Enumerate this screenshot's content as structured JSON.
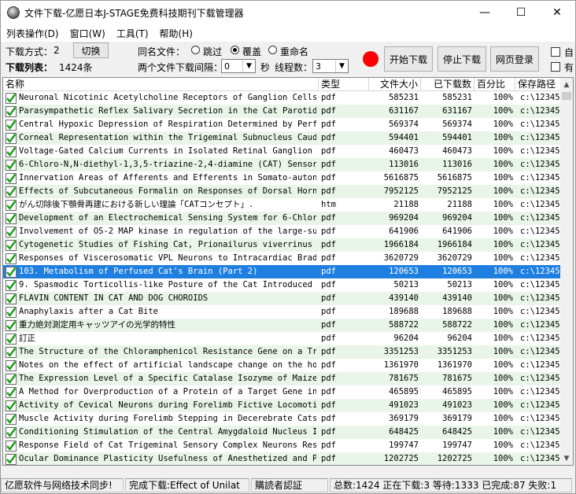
{
  "window": {
    "title": "文件下载-亿愿日本J-STAGE免费科技期刊下载管理器",
    "minimize": "—",
    "maximize": "☐",
    "close": "✕"
  },
  "menu": {
    "items": [
      "列表操作(D)",
      "窗口(W)",
      "工具(T)",
      "帮助(H)"
    ]
  },
  "toolbar": {
    "download_mode_label": "下载方式：",
    "download_mode_value": "2",
    "switch_button": "切换",
    "download_list_label": "下载列表：",
    "download_list_count": "1424条",
    "same_name_label": "同名文件：",
    "radio_skip": "跳过",
    "radio_overwrite": "覆盖",
    "radio_rename": "重命名",
    "interval_label": "两个文件下载间隔：",
    "interval_value": "0",
    "seconds_label": "秒",
    "threads_label": "线程数：",
    "threads_value": "3",
    "start_button": "开始下载",
    "stop_button": "停止下载",
    "web_login_button": "网页登录",
    "check1_label": "自",
    "check2_label": "有"
  },
  "table": {
    "columns": [
      "名称",
      "类型",
      "文件大小",
      "已下载数",
      "百分比",
      "保存路径"
    ],
    "rows": [
      {
        "name": "Neuronal Nicotinic Acetylcholine Receptors of Ganglion Cells...",
        "type": "pdf",
        "size": "585231",
        "done": "585231",
        "pct": "100%",
        "path": "c:\\12345"
      },
      {
        "name": "Parasympathetic Reflex Salivary Secretion in the Cat Parotid...",
        "type": "pdf",
        "size": "631167",
        "done": "631167",
        "pct": "100%",
        "path": "c:\\12345"
      },
      {
        "name": "Central Hypoxic Depression of Respiration Determined by Perf...",
        "type": "pdf",
        "size": "569374",
        "done": "569374",
        "pct": "100%",
        "path": "c:\\12345"
      },
      {
        "name": "Corneal Representation within the Trigeminal Subnucleus Caud...",
        "type": "pdf",
        "size": "594401",
        "done": "594401",
        "pct": "100%",
        "path": "c:\\12345"
      },
      {
        "name": "Voltage-Gated Calcium Currents in Isolated Retinal Ganglion ...",
        "type": "pdf",
        "size": "460473",
        "done": "460473",
        "pct": "100%",
        "path": "c:\\12345"
      },
      {
        "name": "6-Chloro-N,N-diethyl-1,3,5-triazine-2,4-diamine (CAT) Sensor...",
        "type": "pdf",
        "size": "113016",
        "done": "113016",
        "pct": "100%",
        "path": "c:\\12345"
      },
      {
        "name": "Innervation Areas of Afferents and Efferents in Somato-auton...",
        "type": "pdf",
        "size": "5616875",
        "done": "5616875",
        "pct": "100%",
        "path": "c:\\12345"
      },
      {
        "name": "Effects of Subcutaneous Formalin on Responses of Dorsal Horn...",
        "type": "pdf",
        "size": "7952125",
        "done": "7952125",
        "pct": "100%",
        "path": "c:\\12345"
      },
      {
        "name": "がん切除後下顎骨再建における新しい理論「CATコンセプト」.",
        "type": "htm",
        "size": "21188",
        "done": "21188",
        "pct": "100%",
        "path": "c:\\12345"
      },
      {
        "name": "Development of an Electrochemical Sensing System for 6-Chlor...",
        "type": "pdf",
        "size": "969204",
        "done": "969204",
        "pct": "100%",
        "path": "c:\\12345"
      },
      {
        "name": "Involvement of OS-2 MAP kinase in regulation of the large-su...",
        "type": "pdf",
        "size": "641906",
        "done": "641906",
        "pct": "100%",
        "path": "c:\\12345"
      },
      {
        "name": "Cytogenetic Studies of Fishing Cat, Prionailurus viverrinus ...",
        "type": "pdf",
        "size": "1966184",
        "done": "1966184",
        "pct": "100%",
        "path": "c:\\12345"
      },
      {
        "name": "Responses of Viscerosomatic VPL Neurons to Intracardiac Brad...",
        "type": "pdf",
        "size": "3620729",
        "done": "3620729",
        "pct": "100%",
        "path": "c:\\12345"
      },
      {
        "name": "103. Metabolism of Perfused Cat's Brain (Part 2)",
        "type": "pdf",
        "size": "120653",
        "done": "120653",
        "pct": "100%",
        "path": "c:\\12345",
        "selected": true
      },
      {
        "name": "9. Spasmodic Torticollis-like Posture of the Cat Introduced ...",
        "type": "pdf",
        "size": "50213",
        "done": "50213",
        "pct": "100%",
        "path": "c:\\12345"
      },
      {
        "name": "FLAVIN CONTENT IN CAT AND DOG CHOROIDS",
        "type": "pdf",
        "size": "439140",
        "done": "439140",
        "pct": "100%",
        "path": "c:\\12345"
      },
      {
        "name": "Anaphylaxis after a Cat Bite",
        "type": "pdf",
        "size": "189688",
        "done": "189688",
        "pct": "100%",
        "path": "c:\\12345"
      },
      {
        "name": "重力絶対測定用キャッツアイの光学的特性",
        "type": "pdf",
        "size": "588722",
        "done": "588722",
        "pct": "100%",
        "path": "c:\\12345"
      },
      {
        "name": "訂正",
        "type": "pdf",
        "size": "96204",
        "done": "96204",
        "pct": "100%",
        "path": "c:\\12345"
      },
      {
        "name": "The Structure of the Chloramphenicol Resistance Gene on a Tr...",
        "type": "pdf",
        "size": "3351253",
        "done": "3351253",
        "pct": "100%",
        "path": "c:\\12345"
      },
      {
        "name": "Notes on the effect of artificial landscape change on the ho...",
        "type": "pdf",
        "size": "1361970",
        "done": "1361970",
        "pct": "100%",
        "path": "c:\\12345"
      },
      {
        "name": "The Expression Level of a Specific Catalase Isozyme of Maize...",
        "type": "pdf",
        "size": "781675",
        "done": "781675",
        "pct": "100%",
        "path": "c:\\12345"
      },
      {
        "name": "A Method for Overproduction of a Protein of a Target Gene in...",
        "type": "pdf",
        "size": "465895",
        "done": "465895",
        "pct": "100%",
        "path": "c:\\12345"
      },
      {
        "name": "Activity of Cevical Neurons during Forelimb Fictive Locomoti...",
        "type": "pdf",
        "size": "491023",
        "done": "491023",
        "pct": "100%",
        "path": "c:\\12345"
      },
      {
        "name": "Muscle Activity during Forelimb Stepping in Decerebrate Cats",
        "type": "pdf",
        "size": "369179",
        "done": "369179",
        "pct": "100%",
        "path": "c:\\12345"
      },
      {
        "name": "Conditioning Stimulation of the Central Amygdaloid Nucleus I...",
        "type": "pdf",
        "size": "648425",
        "done": "648425",
        "pct": "100%",
        "path": "c:\\12345"
      },
      {
        "name": "Response Field of Cat Trigeminal Sensory Complex Neurons Res...",
        "type": "pdf",
        "size": "199747",
        "done": "199747",
        "pct": "100%",
        "path": "c:\\12345"
      },
      {
        "name": "Ocular Dominance Plasticity Usefulness of Anesthetized and P...",
        "type": "pdf",
        "size": "1202725",
        "done": "1202725",
        "pct": "100%",
        "path": "c:\\12345"
      }
    ]
  },
  "statusbar": {
    "company": "亿愿软件与网络技术同步!",
    "completed": "完成下载:Effect of Unilat",
    "reader_auth": "購読者認証",
    "summary": "总数:1424 正在下载:3 等待:1333 已完成:87 失败:1"
  },
  "colors": {
    "selected_row": "#1f7fe0",
    "alt_row": "#e9f5e9",
    "check_green": "#1a9a1a",
    "record_red": "#ff0000"
  }
}
